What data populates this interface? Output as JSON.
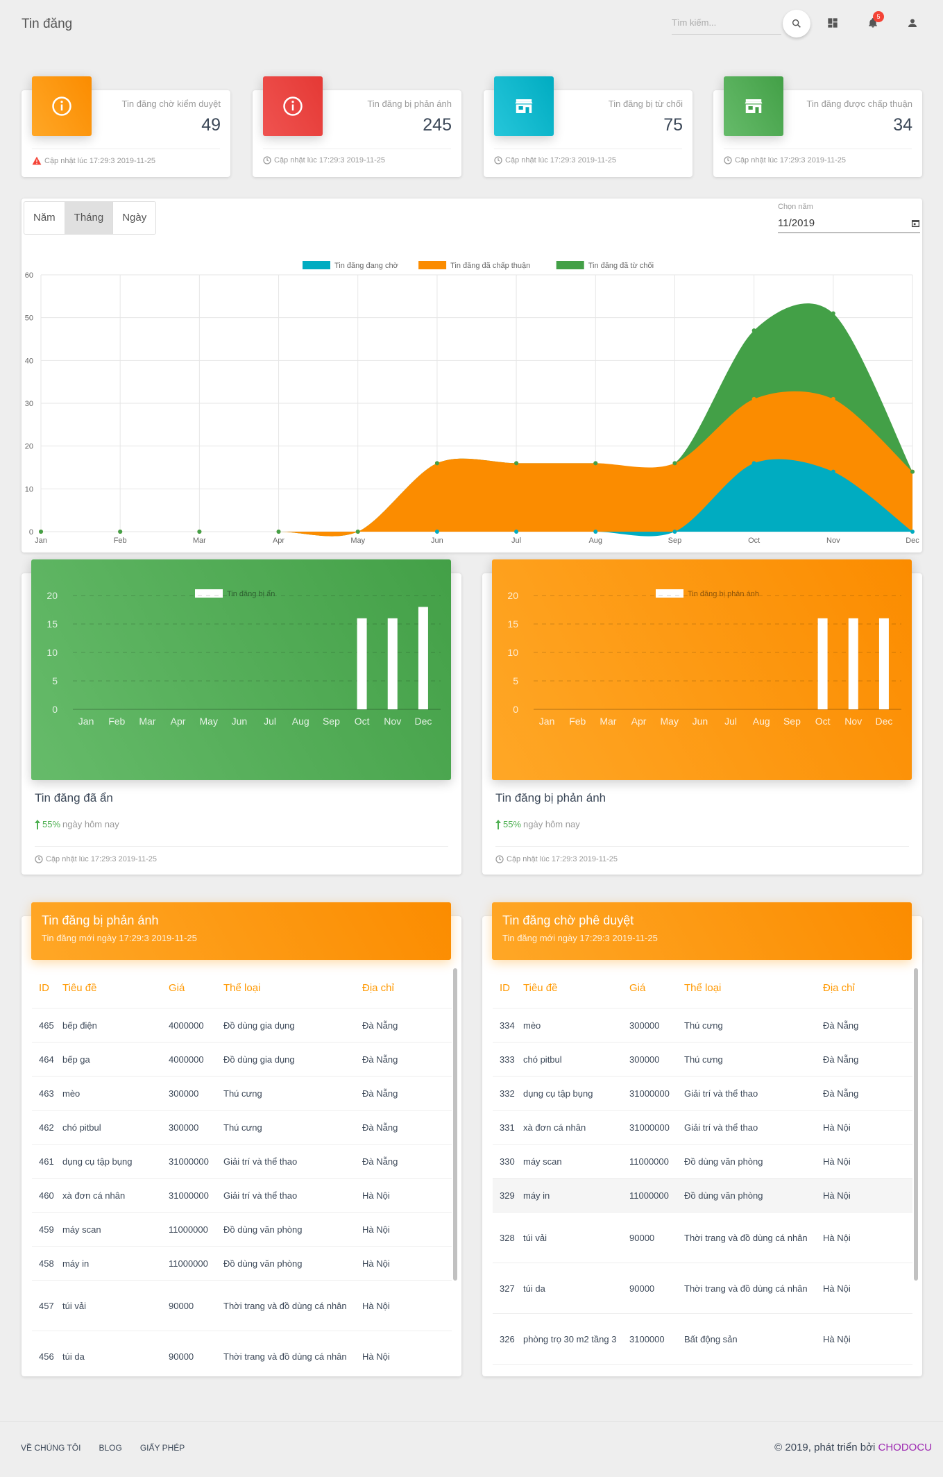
{
  "header": {
    "title": "Tin đăng",
    "search_placeholder": "Tìm kiếm...",
    "notification_count": "5"
  },
  "stats": [
    {
      "label": "Tin đăng chờ kiểm duyệt",
      "value": "49",
      "updated": "Cập nhật lúc 17:29:3 2019-11-25",
      "color": "#ff9800",
      "icon": "info-icon",
      "footer_icon": "warning-icon"
    },
    {
      "label": "Tin đăng bị phản ánh",
      "value": "245",
      "updated": "Cập nhật lúc 17:29:3 2019-11-25",
      "color": "#f44336",
      "icon": "info-icon",
      "footer_icon": "clock-icon"
    },
    {
      "label": "Tin đăng bị từ chối",
      "value": "75",
      "updated": "Cập nhật lúc 17:29:3 2019-11-25",
      "color": "#00acc1",
      "icon": "store-icon",
      "footer_icon": "clock-icon"
    },
    {
      "label": "Tin đăng được chấp thuận",
      "value": "34",
      "updated": "Cập nhật lúc 17:29:3 2019-11-25",
      "color": "#4caf50",
      "icon": "store-icon",
      "footer_icon": "clock-icon"
    }
  ],
  "filters": {
    "tabs": [
      "Năm",
      "Tháng",
      "Ngày"
    ],
    "active": 1,
    "year_label": "Chọn năm",
    "year_value": "11/2019"
  },
  "chart_data": [
    {
      "type": "area",
      "title": "",
      "categories": [
        "Jan",
        "Feb",
        "Mar",
        "Apr",
        "May",
        "Jun",
        "Jul",
        "Aug",
        "Sep",
        "Oct",
        "Nov",
        "Dec"
      ],
      "ylim": [
        0,
        60
      ],
      "yticks": [
        0,
        10,
        20,
        30,
        40,
        50,
        60
      ],
      "stacked": true,
      "grid": true,
      "legend_position": "top",
      "series": [
        {
          "name": "Tin đăng đang chờ",
          "color": "#00acc1",
          "values": [
            0,
            0,
            0,
            0,
            0,
            0,
            0,
            0,
            0,
            16,
            14,
            0
          ]
        },
        {
          "name": "Tin đăng đã chấp thuận",
          "color": "#fb8c00",
          "values": [
            0,
            0,
            0,
            0,
            0,
            16,
            16,
            16,
            16,
            15,
            17,
            14
          ]
        },
        {
          "name": "Tin đăng đã từ chối",
          "color": "#43a047",
          "values": [
            0,
            0,
            0,
            0,
            0,
            0,
            0,
            0,
            0,
            16,
            20,
            0
          ]
        }
      ]
    },
    {
      "type": "bar",
      "title": "",
      "categories": [
        "Jan",
        "Feb",
        "Mar",
        "Apr",
        "May",
        "Jun",
        "Jul",
        "Aug",
        "Sep",
        "Oct",
        "Nov",
        "Dec"
      ],
      "ylim": [
        0,
        20
      ],
      "yticks": [
        0,
        5,
        10,
        15,
        20
      ],
      "grid": true,
      "legend_position": "top",
      "series": [
        {
          "name": "Tin đăng bị ẩn",
          "values": [
            0,
            0,
            0,
            0,
            0,
            0,
            0,
            0,
            0,
            16,
            16,
            18
          ]
        }
      ]
    },
    {
      "type": "bar",
      "title": "",
      "categories": [
        "Jan",
        "Feb",
        "Mar",
        "Apr",
        "May",
        "Jun",
        "Jul",
        "Aug",
        "Sep",
        "Oct",
        "Nov",
        "Dec"
      ],
      "ylim": [
        0,
        20
      ],
      "yticks": [
        0,
        5,
        10,
        15,
        20
      ],
      "grid": true,
      "legend_position": "top",
      "series": [
        {
          "name": "Tin đăng bị phản ánh",
          "values": [
            0,
            0,
            0,
            0,
            0,
            0,
            0,
            0,
            0,
            16,
            16,
            16
          ]
        }
      ]
    }
  ],
  "bar_cards": [
    {
      "title": "Tin đăng đã ẩn",
      "pct": "55%",
      "stat_text": "ngày hôm nay",
      "updated": "Cập nhật lúc 17:29:3 2019-11-25"
    },
    {
      "title": "Tin đăng bị phản ánh",
      "pct": "55%",
      "stat_text": "ngày hôm nay",
      "updated": "Cập nhật lúc 17:29:3 2019-11-25"
    }
  ],
  "tables": [
    {
      "title": "Tin đăng bị phản ánh",
      "subtitle": "Tin đăng mới ngày 17:29:3 2019-11-25",
      "columns": [
        "ID",
        "Tiêu đề",
        "Giá",
        "Thể loại",
        "Địa chỉ"
      ],
      "rows": [
        [
          "465",
          "bếp điện",
          "4000000",
          "Đồ dùng gia dụng",
          "Đà Nẵng"
        ],
        [
          "464",
          "bếp ga",
          "4000000",
          "Đồ dùng gia dụng",
          "Đà Nẵng"
        ],
        [
          "463",
          "mèo",
          "300000",
          "Thú cưng",
          "Đà Nẵng"
        ],
        [
          "462",
          "chó pitbul",
          "300000",
          "Thú cưng",
          "Đà Nẵng"
        ],
        [
          "461",
          "dụng cụ tập bụng",
          "31000000",
          "Giải trí và thể thao",
          "Đà Nẵng"
        ],
        [
          "460",
          "xà đơn cá nhân",
          "31000000",
          "Giải trí và thể thao",
          "Hà Nội"
        ],
        [
          "459",
          "máy scan",
          "11000000",
          "Đồ dùng văn phòng",
          "Hà Nội"
        ],
        [
          "458",
          "máy in",
          "11000000",
          "Đồ dùng văn phòng",
          "Hà Nội"
        ],
        [
          "457",
          "túi vải",
          "90000",
          "Thời trang và đồ dùng cá nhân",
          "Hà Nội"
        ],
        [
          "456",
          "túi da",
          "90000",
          "Thời trang và đồ dùng cá nhân",
          "Hà Nội"
        ]
      ]
    },
    {
      "title": "Tin đăng chờ phê duyệt",
      "subtitle": "Tin đăng mới ngày 17:29:3 2019-11-25",
      "columns": [
        "ID",
        "Tiêu đề",
        "Giá",
        "Thể loại",
        "Địa chỉ"
      ],
      "rows": [
        [
          "334",
          "mèo",
          "300000",
          "Thú cưng",
          "Đà Nẵng"
        ],
        [
          "333",
          "chó pitbul",
          "300000",
          "Thú cưng",
          "Đà Nẵng"
        ],
        [
          "332",
          "dụng cụ tập bụng",
          "31000000",
          "Giải trí và thể thao",
          "Đà Nẵng"
        ],
        [
          "331",
          "xà đơn cá nhân",
          "31000000",
          "Giải trí và thể thao",
          "Hà Nội"
        ],
        [
          "330",
          "máy scan",
          "11000000",
          "Đồ dùng văn phòng",
          "Hà Nội"
        ],
        [
          "329",
          "máy in",
          "11000000",
          "Đồ dùng văn phòng",
          "Hà Nội"
        ],
        [
          "328",
          "túi vải",
          "90000",
          "Thời trang và đồ dùng cá nhân",
          "Hà Nội"
        ],
        [
          "327",
          "túi da",
          "90000",
          "Thời trang và đồ dùng cá nhân",
          "Hà Nội"
        ],
        [
          "326",
          "phòng trọ 30 m2 tầng 3",
          "3100000",
          "Bất động sản",
          "Hà Nội"
        ]
      ]
    }
  ],
  "footer": {
    "links": [
      "VỀ CHÚNG TÔI",
      "BLOG",
      "GIẤY PHÉP"
    ],
    "copyright": "© 2019, phát triển bởi",
    "brand": "CHODOCU"
  }
}
